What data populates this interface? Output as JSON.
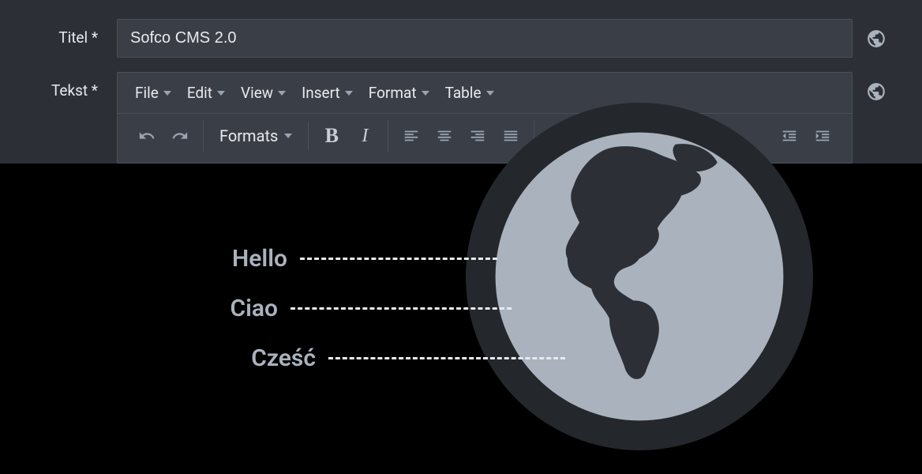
{
  "form": {
    "title_label": "Titel *",
    "title_value": "Sofco CMS 2.0",
    "text_label": "Tekst *"
  },
  "editor": {
    "menubar": [
      "File",
      "Edit",
      "View",
      "Insert",
      "Format",
      "Table"
    ],
    "formats_label": "Formats"
  },
  "illustration": {
    "greetings": [
      "Hello",
      "Ciao",
      "Cześć"
    ]
  }
}
